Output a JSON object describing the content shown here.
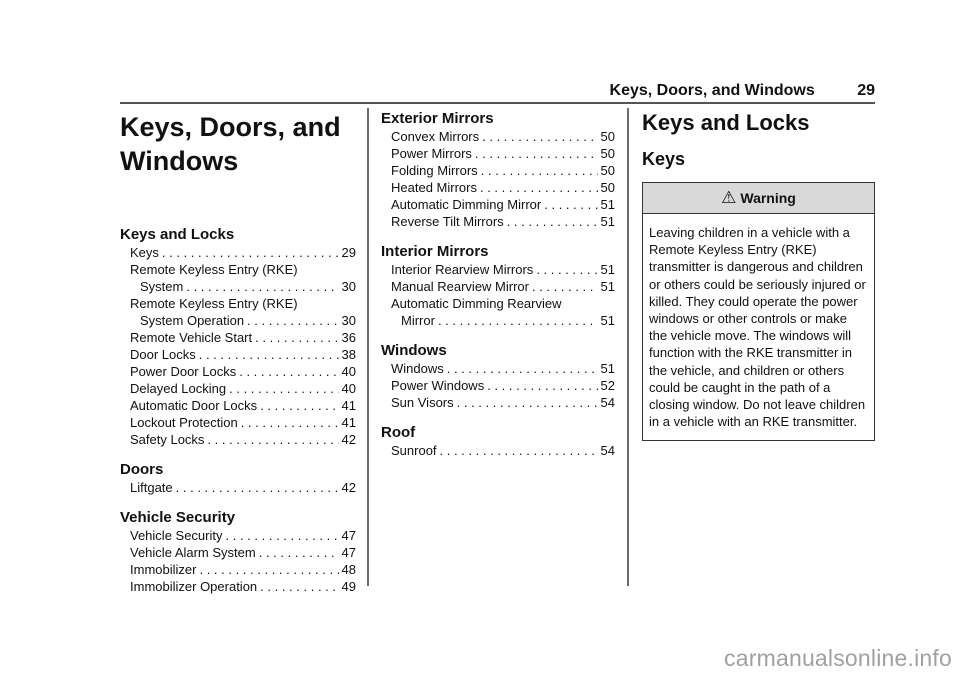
{
  "running_head": {
    "title": "Keys, Doors, and Windows",
    "page_number": "29"
  },
  "chapter_title_lines": [
    "Keys, Doors, and",
    "Windows"
  ],
  "toc_columns": [
    {
      "sections": [
        {
          "heading": "Keys and Locks",
          "items": [
            {
              "label": "Keys",
              "page": "29"
            },
            {
              "label": "Remote Keyless Entry (RKE)",
              "label2": "System",
              "page": "30"
            },
            {
              "label": "Remote Keyless Entry (RKE)",
              "label2": "System Operation",
              "page": "30"
            },
            {
              "label": "Remote Vehicle Start",
              "page": "36"
            },
            {
              "label": "Door Locks",
              "page": "38"
            },
            {
              "label": "Power Door Locks",
              "page": "40"
            },
            {
              "label": "Delayed Locking",
              "page": "40"
            },
            {
              "label": "Automatic Door Locks",
              "page": "41"
            },
            {
              "label": "Lockout Protection",
              "page": "41"
            },
            {
              "label": "Safety Locks",
              "page": "42"
            }
          ]
        },
        {
          "heading": "Doors",
          "items": [
            {
              "label": "Liftgate",
              "page": "42"
            }
          ]
        },
        {
          "heading": "Vehicle Security",
          "items": [
            {
              "label": "Vehicle Security",
              "page": "47"
            },
            {
              "label": "Vehicle Alarm System",
              "page": "47"
            },
            {
              "label": "Immobilizer",
              "page": "48"
            },
            {
              "label": "Immobilizer Operation",
              "page": "49"
            }
          ]
        }
      ]
    },
    {
      "sections": [
        {
          "heading": "Exterior Mirrors",
          "items": [
            {
              "label": "Convex Mirrors",
              "page": "50"
            },
            {
              "label": "Power Mirrors",
              "page": "50"
            },
            {
              "label": "Folding Mirrors",
              "page": "50"
            },
            {
              "label": "Heated Mirrors",
              "page": "50"
            },
            {
              "label": "Automatic Dimming Mirror",
              "page": "51"
            },
            {
              "label": "Reverse Tilt Mirrors",
              "page": "51"
            }
          ]
        },
        {
          "heading": "Interior Mirrors",
          "items": [
            {
              "label": "Interior Rearview Mirrors",
              "page": "51"
            },
            {
              "label": "Manual Rearview Mirror",
              "page": "51"
            },
            {
              "label": "Automatic Dimming Rearview",
              "label2": "Mirror",
              "page": "51"
            }
          ]
        },
        {
          "heading": "Windows",
          "items": [
            {
              "label": "Windows",
              "page": "51"
            },
            {
              "label": "Power Windows",
              "page": "52"
            },
            {
              "label": "Sun Visors",
              "page": "54"
            }
          ]
        },
        {
          "heading": "Roof",
          "items": [
            {
              "label": "Sunroof",
              "page": "54"
            }
          ]
        }
      ]
    }
  ],
  "body": {
    "section_heading": "Keys and Locks",
    "subsection_heading": "Keys",
    "warning": {
      "icon": "warning-triangle-icon",
      "icon_glyph": "⚠",
      "title": "Warning",
      "text": "Leaving children in a vehicle with a Remote Keyless Entry (RKE) transmitter is dangerous and children or others could be seriously injured or killed. They could operate the power windows or other controls or make the vehicle move. The windows will function with the RKE transmitter in the vehicle, and children or others could be caught in the path of a closing window. Do not leave children in a vehicle with an RKE transmitter."
    }
  },
  "watermark": "carmanualsonline.info"
}
